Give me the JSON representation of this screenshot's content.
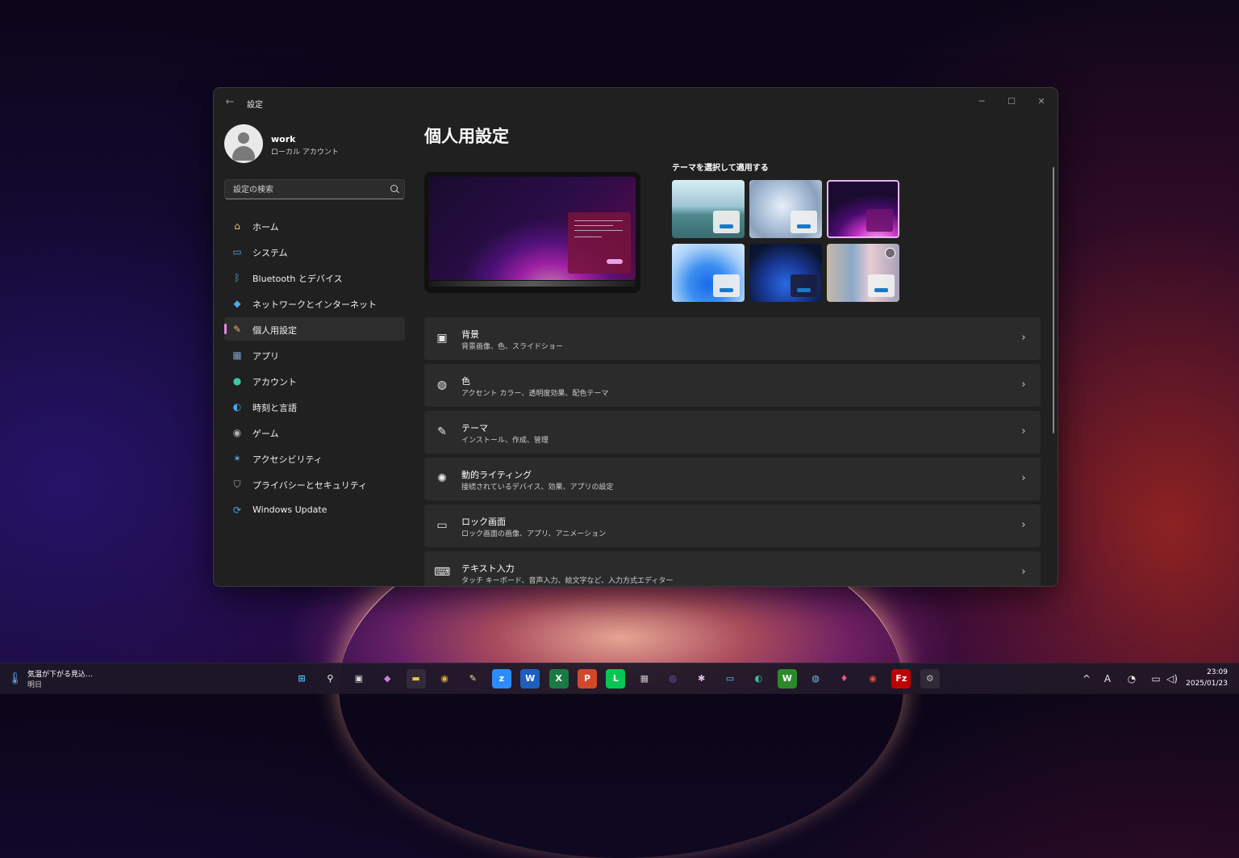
{
  "window": {
    "app_title": "設定",
    "back_icon": "back-arrow-icon",
    "controls": {
      "minimize": "─",
      "maximize": "☐",
      "close": "✕"
    }
  },
  "profile": {
    "name": "work",
    "account_type": "ローカル アカウント"
  },
  "search": {
    "placeholder": "設定の検索"
  },
  "nav": {
    "items": [
      {
        "label": "ホーム",
        "icon": "home-icon",
        "glyph": "⌂",
        "color": "#f0c070"
      },
      {
        "label": "システム",
        "icon": "system-icon",
        "glyph": "▭",
        "color": "#4aa8e8"
      },
      {
        "label": "Bluetooth とデバイス",
        "icon": "bluetooth-icon",
        "glyph": "ᛒ",
        "color": "#4aa8e8"
      },
      {
        "label": "ネットワークとインターネット",
        "icon": "wifi-icon",
        "glyph": "◆",
        "color": "#4aa8e8"
      },
      {
        "label": "個人用設定",
        "icon": "brush-icon",
        "glyph": "✎",
        "color": "#f0b060",
        "active": true
      },
      {
        "label": "アプリ",
        "icon": "apps-icon",
        "glyph": "▦",
        "color": "#7aa0c8"
      },
      {
        "label": "アカウント",
        "icon": "account-icon",
        "glyph": "●",
        "color": "#3cc8a0"
      },
      {
        "label": "時刻と言語",
        "icon": "clock-globe-icon",
        "glyph": "◐",
        "color": "#4aa8e8"
      },
      {
        "label": "ゲーム",
        "icon": "gamepad-icon",
        "glyph": "◉",
        "color": "#b0b0b0"
      },
      {
        "label": "アクセシビリティ",
        "icon": "accessibility-icon",
        "glyph": "✶",
        "color": "#4aa8e8"
      },
      {
        "label": "プライバシーとセキュリティ",
        "icon": "shield-icon",
        "glyph": "⛉",
        "color": "#a8a8a8"
      },
      {
        "label": "Windows Update",
        "icon": "windows-update-icon",
        "glyph": "⟳",
        "color": "#4aa8e8"
      }
    ]
  },
  "main": {
    "page_title": "個人用設定",
    "themes_label": "テーマを選択して適用する",
    "themes": [
      {
        "name": "theme-glow-lake",
        "bg": "linear-gradient(180deg,#d8eef4 0%,#9fc6d4 45%,#4f8a8f 60%,#3a6a70 100%)",
        "mini": "light"
      },
      {
        "name": "theme-captured-motion",
        "bg": "radial-gradient(circle at 45% 45%,#e8eef8 0%,#b0c4dc 40%,#8aa0bc 70%,#c8d4e4 100%)",
        "mini": "light"
      },
      {
        "name": "theme-windows-glow-dark",
        "bg": "radial-gradient(ellipse 80px 60px at 70% 110%,#ffb0f0 0%,#c030c0 35%,#4a0b70 65%,#1a0b30 100%)",
        "mini": "purple",
        "selected": true
      },
      {
        "name": "theme-windows-light",
        "bg": "radial-gradient(circle at 50% 70%,#1a6ae8 0%,#3a8ef0 35%,#a8d0f8 70%,#d8ecfc 100%)",
        "mini": "light"
      },
      {
        "name": "theme-windows-dark",
        "bg": "radial-gradient(circle at 50% 70%,#2a6ae0 0%,#1a3a9a 40%,#0a1430 80%)",
        "mini": "dark"
      },
      {
        "name": "theme-spotlight",
        "bg": "linear-gradient(90deg,#c8b8a8 0%,#8aa8c8 35%,#e8ccd4 60%,#a8a0b8 100%)",
        "mini": "light",
        "icon": true
      }
    ],
    "rows": [
      {
        "title": "背景",
        "subtitle": "背景画像、色、スライドショー",
        "icon": "image-icon",
        "glyph": "▣"
      },
      {
        "title": "色",
        "subtitle": "アクセント カラー、透明度効果、配色テーマ",
        "icon": "palette-icon",
        "glyph": "◍"
      },
      {
        "title": "テーマ",
        "subtitle": "インストール、作成、管理",
        "icon": "brush-icon",
        "glyph": "✎"
      },
      {
        "title": "動的ライティング",
        "subtitle": "接続されているデバイス、効果、アプリの設定",
        "icon": "lighting-icon",
        "glyph": "✺"
      },
      {
        "title": "ロック画面",
        "subtitle": "ロック画面の画像、アプリ、アニメーション",
        "icon": "lock-screen-icon",
        "glyph": "▭"
      },
      {
        "title": "テキスト入力",
        "subtitle": "タッチ キーボード、音声入力、絵文字など、入力方式エディター",
        "icon": "keyboard-icon",
        "glyph": "⌨"
      }
    ],
    "chevron": "›"
  },
  "taskbar": {
    "weather_text": "気温が下がる見込…",
    "weather_sub": "明日",
    "apps": [
      {
        "name": "start-icon",
        "glyph": "⊞",
        "bg": "transparent",
        "color": "#4cc2ff"
      },
      {
        "name": "search-icon",
        "glyph": "⚲",
        "bg": "transparent",
        "color": "#ffffff"
      },
      {
        "name": "task-view-icon",
        "glyph": "▣",
        "bg": "transparent",
        "color": "#d8d8d8"
      },
      {
        "name": "copilot-icon",
        "glyph": "◆",
        "bg": "transparent",
        "color": "#c87af0"
      },
      {
        "name": "file-explorer-icon",
        "glyph": "▬",
        "bg": "transparent",
        "color": "#f0c040",
        "active": true
      },
      {
        "name": "chrome-icon",
        "glyph": "◉",
        "bg": "transparent",
        "color": "#e8b030"
      },
      {
        "name": "notepad-icon",
        "glyph": "✎",
        "bg": "transparent",
        "color": "#e8e0a0"
      },
      {
        "name": "zoom-icon",
        "glyph": "z",
        "bg": "#2d8cff",
        "color": "#ffffff"
      },
      {
        "name": "word-icon",
        "glyph": "W",
        "bg": "#1d5fbf",
        "color": "#ffffff"
      },
      {
        "name": "excel-icon",
        "glyph": "X",
        "bg": "#1a7a44",
        "color": "#ffffff"
      },
      {
        "name": "powerpoint-icon",
        "glyph": "P",
        "bg": "#d2482a",
        "color": "#ffffff"
      },
      {
        "name": "line-icon",
        "glyph": "L",
        "bg": "#06c755",
        "color": "#ffffff"
      },
      {
        "name": "calculator-icon",
        "glyph": "▦",
        "bg": "transparent",
        "color": "#c8c8c8"
      },
      {
        "name": "messenger-icon",
        "glyph": "◎",
        "bg": "transparent",
        "color": "#7a6af0"
      },
      {
        "name": "slack-icon",
        "glyph": "✱",
        "bg": "transparent",
        "color": "#e0c0f0"
      },
      {
        "name": "remote-desktop-icon",
        "glyph": "▭",
        "bg": "transparent",
        "color": "#7ac0f0"
      },
      {
        "name": "edge-icon",
        "glyph": "◐",
        "bg": "transparent",
        "color": "#3ac0a0"
      },
      {
        "name": "w-app-icon",
        "glyph": "W",
        "bg": "#2a8a2a",
        "color": "#ffffff"
      },
      {
        "name": "globe-icon",
        "glyph": "◍",
        "bg": "transparent",
        "color": "#6ac0e0"
      },
      {
        "name": "droplet-icon",
        "glyph": "♦",
        "bg": "transparent",
        "color": "#e05a8a"
      },
      {
        "name": "chrome-alt-icon",
        "glyph": "◉",
        "bg": "transparent",
        "color": "#e84a3a"
      },
      {
        "name": "filezilla-icon",
        "glyph": "Fz",
        "bg": "#bf0000",
        "color": "#ffffff"
      },
      {
        "name": "settings-gear-icon",
        "glyph": "⚙",
        "bg": "transparent",
        "color": "#b8b8b8",
        "active": true
      }
    ],
    "tray": [
      {
        "name": "show-hidden-icons-icon",
        "glyph": "^"
      },
      {
        "name": "ime-icon",
        "glyph": "A"
      },
      {
        "name": "focus-icon",
        "glyph": "◔"
      },
      {
        "name": "network-icon",
        "glyph": "▭"
      },
      {
        "name": "volume-icon",
        "glyph": "◁)"
      }
    ],
    "clock_time": "23:09",
    "clock_date": "2025/01/23"
  }
}
